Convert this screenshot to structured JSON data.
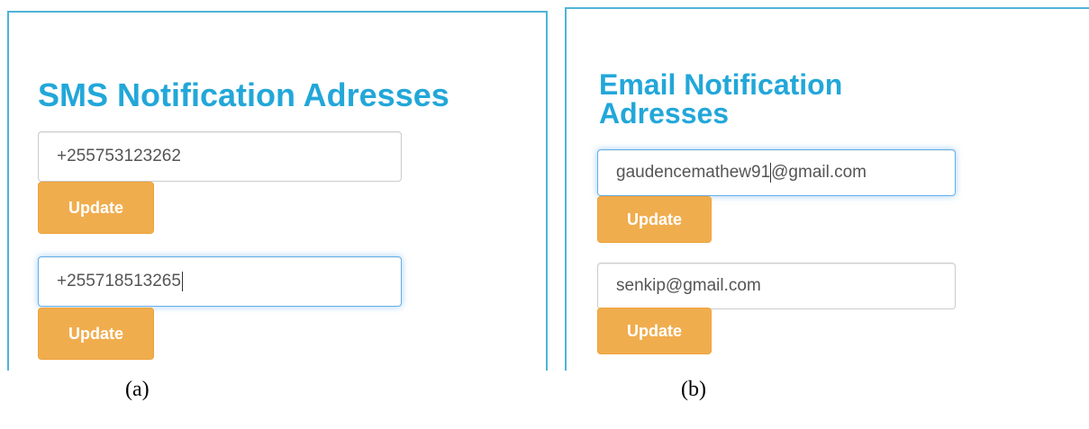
{
  "sms_panel": {
    "title": "SMS Notification Adresses",
    "entries": [
      {
        "value": "+255753123262",
        "button_label": "Update",
        "focused": false
      },
      {
        "value": "+255718513265",
        "button_label": "Update",
        "focused": true
      }
    ]
  },
  "email_panel": {
    "title": "Email Notification Adresses",
    "entries": [
      {
        "value_before_caret": "gaudencemathew91",
        "value_after_caret": "@gmail.com",
        "button_label": "Update",
        "focused": true
      },
      {
        "value": "senkip@gmail.com",
        "button_label": "Update",
        "focused": false
      }
    ]
  },
  "captions": {
    "a": "(a)",
    "b": "(b)"
  },
  "colors": {
    "accent": "#22a7d9",
    "panel_border": "#4fb3d9",
    "button": "#f0ad4e",
    "focus_border": "#66afe9"
  }
}
